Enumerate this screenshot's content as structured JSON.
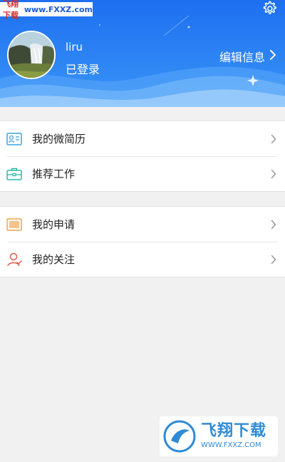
{
  "watermark_top": {
    "cn": "飞翔下载",
    "url": "www.FXXZ.com"
  },
  "header": {
    "username": "liru",
    "status": "已登录",
    "edit_label": "编辑信息"
  },
  "menu": {
    "group1": [
      {
        "label": "我的微简历",
        "icon": "resume-card-icon"
      },
      {
        "label": "推荐工作",
        "icon": "briefcase-icon"
      }
    ],
    "group2": [
      {
        "label": "我的申请",
        "icon": "application-icon"
      },
      {
        "label": "我的关注",
        "icon": "follow-user-icon"
      }
    ]
  },
  "watermark_bottom": {
    "big": "飞翔下载",
    "small": "WWW.FXXZ.COM"
  },
  "colors": {
    "header_blue": "#1e6ff0",
    "resume_icon": "#3aa3e0",
    "briefcase_icon": "#2bb8a6",
    "application_icon": "#f0a050",
    "follow_icon": "#e0584a"
  }
}
